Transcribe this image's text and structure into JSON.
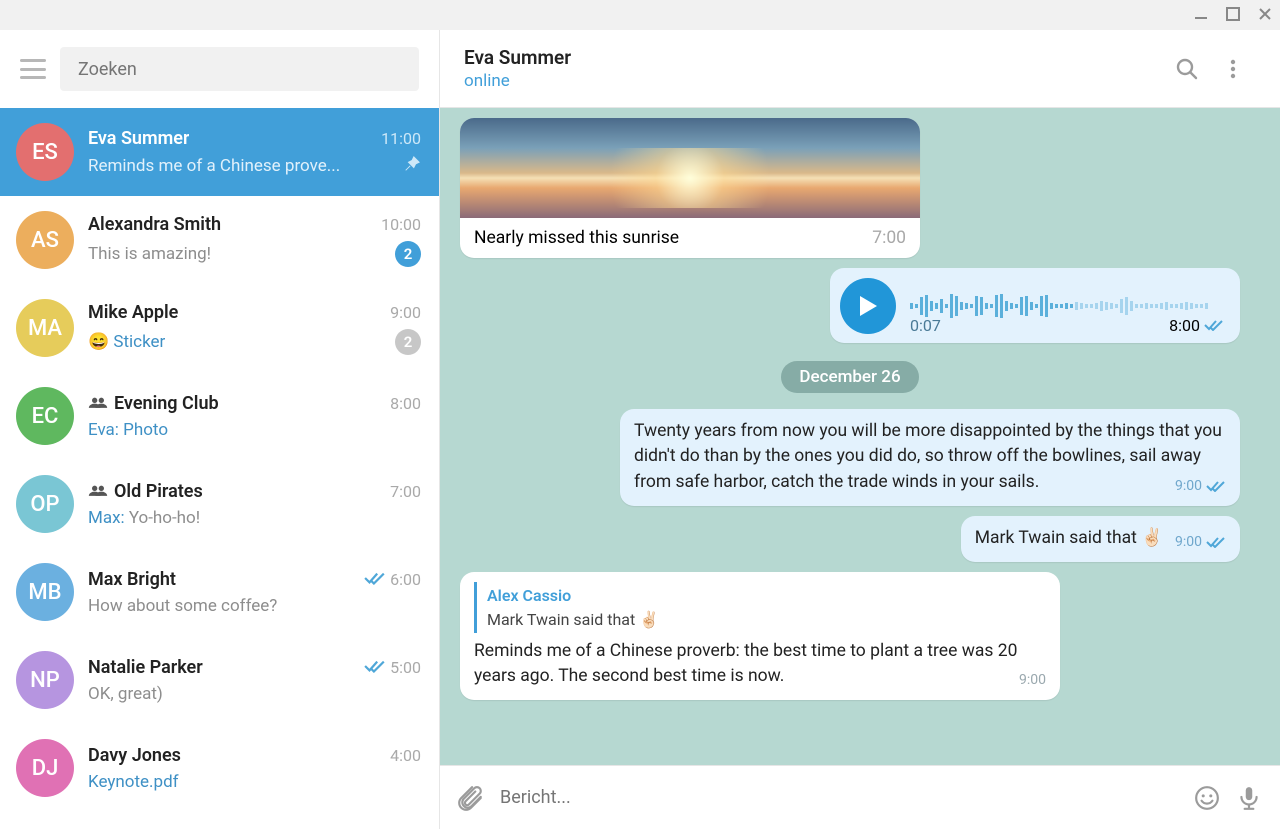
{
  "search": {
    "placeholder": "Zoeken"
  },
  "chats": [
    {
      "initials": "ES",
      "color": "#e36f6f",
      "name": "Eva Summer",
      "time": "11:00",
      "preview": "Reminds me of a Chinese prove...",
      "active": true,
      "pinned": true
    },
    {
      "initials": "AS",
      "color": "#ecae5d",
      "name": "Alexandra Smith",
      "time": "10:00",
      "preview": "This is amazing!",
      "badge": "2",
      "badgeColor": "blue"
    },
    {
      "initials": "MA",
      "color": "#e6cc5b",
      "name": "Mike Apple",
      "time": "9:00",
      "preview": "😄 ",
      "link": "Sticker",
      "badge": "2",
      "badgeColor": "gray"
    },
    {
      "initials": "EC",
      "color": "#5fb85f",
      "name": "Evening Club",
      "time": "8:00",
      "sender": "Eva: ",
      "link": "Photo",
      "group": true
    },
    {
      "initials": "OP",
      "color": "#7ac6d4",
      "name": "Old Pirates",
      "time": "7:00",
      "sender": "Max: ",
      "preview": "Yo-ho-ho!",
      "group": true
    },
    {
      "initials": "MB",
      "color": "#6bb0e0",
      "name": "Max Bright",
      "time": "6:00",
      "preview": "How about some coffee?",
      "read": true
    },
    {
      "initials": "NP",
      "color": "#b695e0",
      "name": "Natalie Parker",
      "time": "5:00",
      "preview": "OK, great)",
      "read": true
    },
    {
      "initials": "DJ",
      "color": "#e071b4",
      "name": "Davy Jones",
      "time": "4:00",
      "link": "Keynote.pdf"
    }
  ],
  "header": {
    "name": "Eva Summer",
    "status": "online"
  },
  "messages": {
    "img_caption": "Nearly missed this sunrise",
    "img_time": "7:00",
    "voice_duration": "0:07",
    "voice_time": "8:00",
    "date": "December 26",
    "quote": "Twenty years from now you will be more disappointed by the things that you didn't do than by the ones you did do, so throw off the bowlines, sail away from safe harbor, catch the trade winds in your sails.",
    "quote_time": "9:00",
    "twain": "Mark Twain said that ✌🏻",
    "twain_time": "9:00",
    "reply_name": "Alex Cassio",
    "reply_text": "Mark Twain said that ✌🏻",
    "proverb": "Reminds me of a Chinese proverb: the best time to plant a tree was 20 years ago. The second best time is now.",
    "proverb_time": "9:00"
  },
  "composer": {
    "placeholder": "Bericht..."
  }
}
